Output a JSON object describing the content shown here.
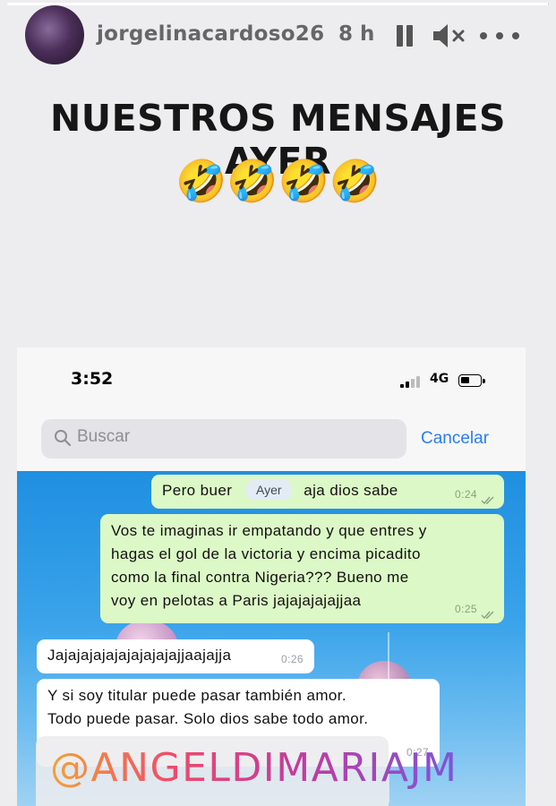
{
  "story": {
    "progress": 0.999,
    "username": "jorgelinacardoso26",
    "time_ago": "8 h",
    "caption": "NUESTROS MENSAJES AYER",
    "emojis": "🤣🤣🤣🤣",
    "mention": "@ANGELDIMARIAJM"
  },
  "icons": {
    "pause": "pause-icon",
    "mute": "speaker-muted-icon",
    "more": "more-horizontal-icon",
    "search": "search-icon"
  },
  "phone": {
    "status_time": "3:52",
    "network": "4G",
    "search_placeholder": "Buscar",
    "cancel_label": "Cancelar"
  },
  "chat": {
    "day_label": "Ayer",
    "messages": [
      {
        "direction": "out",
        "text_before": "Pero buer",
        "text_after": "aja dios sabe",
        "time": "0:24"
      },
      {
        "direction": "out",
        "lines": [
          "Vos te imaginas ir empatando y que entres y",
          "hagas el gol de la victoria y encima picadito",
          "como la final contra Nigeria??? Bueno me",
          "voy en pelotas a Paris jajajajajajjaa"
        ],
        "time": "0:25"
      },
      {
        "direction": "in",
        "text": "Jajajajajajajajajajajjaajajja",
        "time": "0:26"
      },
      {
        "direction": "in",
        "lines": [
          "Y si soy titular puede pasar también amor.",
          "Todo puede pasar. Solo dios sabe todo amor."
        ],
        "time": "0:27"
      }
    ]
  },
  "colors": {
    "outgoing_bubble": "#dcf8c6",
    "incoming_bubble": "#ffffff",
    "link_blue": "#2a7df1",
    "chat_background": "#1f8fe0"
  }
}
